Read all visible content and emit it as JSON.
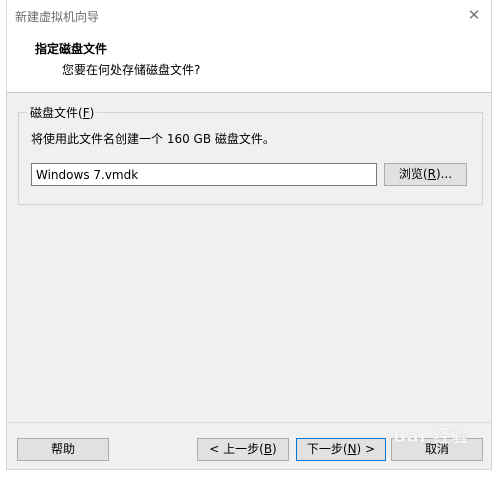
{
  "window": {
    "title": "新建虚拟机向导",
    "close_glyph": "✕"
  },
  "header": {
    "title": "指定磁盘文件",
    "subtitle": "您要在何处存储磁盘文件?"
  },
  "disk_file": {
    "group_label_prefix": "磁盘文件(",
    "group_label_key": "F",
    "group_label_suffix": ")",
    "description": "将使用此文件名创建一个 160 GB 磁盘文件。",
    "filename_value": "Windows 7.vmdk",
    "browse_prefix": "浏览(",
    "browse_key": "R",
    "browse_suffix": ")..."
  },
  "footer": {
    "help_label": "帮助",
    "back_prefix": "< 上一步(",
    "back_key": "B",
    "back_suffix": ")",
    "next_prefix": "下一步(",
    "next_key": "N",
    "next_suffix": ") >",
    "cancel_label": "取消"
  },
  "watermark": "Bai 经验",
  "colors": {
    "accent": "#0078d7",
    "dialog_bg": "#f0f0f0",
    "header_bg": "#ffffff"
  }
}
